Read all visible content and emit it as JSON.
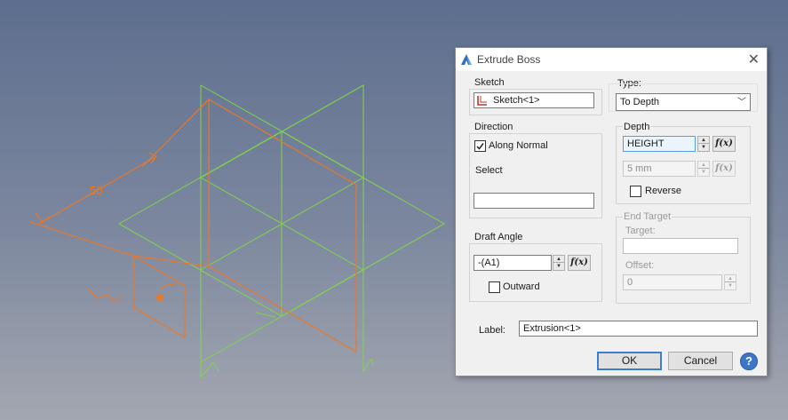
{
  "viewport": {
    "dimension_value": "50",
    "wire_color": "#7fd64a",
    "sketch_color": "#e8782a"
  },
  "dialog": {
    "title": "Extrude Boss",
    "sketch": {
      "group_label": "Sketch",
      "value": "Sketch<1>",
      "icon": "sketch-icon"
    },
    "direction": {
      "group_label": "Direction",
      "along_normal_label": "Along Normal",
      "along_normal_checked": true,
      "select_label": "Select",
      "select_value": ""
    },
    "draft_angle": {
      "group_label": "Draft Angle",
      "value": "-(A1)",
      "fx_label": "f(x)",
      "outward_label": "Outward",
      "outward_checked": false
    },
    "type": {
      "label": "Type:",
      "value": "To Depth"
    },
    "depth": {
      "group_label": "Depth",
      "value": "HEIGHT",
      "fx_label": "f(x)",
      "second_value": "5 mm",
      "second_fx_label": "f(x)",
      "reverse_label": "Reverse",
      "reverse_checked": false
    },
    "end_target": {
      "group_label": "End Target",
      "target_label": "Target:",
      "target_value": "",
      "offset_label": "Offset:",
      "offset_value": "0"
    },
    "label": {
      "label": "Label:",
      "value": "Extrusion<1>"
    },
    "buttons": {
      "ok": "OK",
      "cancel": "Cancel",
      "help": "?"
    },
    "accent_color": "#3c7fcf"
  }
}
